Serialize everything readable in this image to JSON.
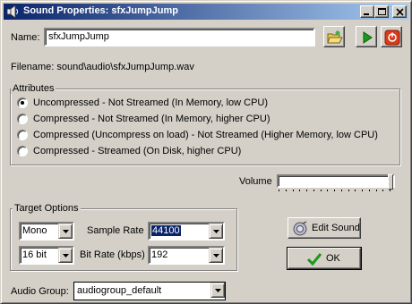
{
  "window": {
    "title": "Sound Properties: sfxJumpJump"
  },
  "name": {
    "label": "Name:",
    "value": "sfxJumpJump"
  },
  "filename": {
    "text": "Filename: sound\\audio\\sfxJumpJump.wav"
  },
  "toolbar": {
    "load_icon": "folder-open-icon",
    "play_icon": "play-icon",
    "stop_icon": "stop-icon"
  },
  "attributes": {
    "title": "Attributes",
    "options": [
      {
        "label": "Uncompressed - Not Streamed (In Memory, low CPU)",
        "selected": true
      },
      {
        "label": "Compressed - Not Streamed (In Memory, higher CPU)",
        "selected": false
      },
      {
        "label": "Compressed (Uncompress on load) - Not Streamed (Higher Memory, low CPU)",
        "selected": false
      },
      {
        "label": "Compressed - Streamed (On Disk, higher CPU)",
        "selected": false
      }
    ]
  },
  "volume": {
    "label": "Volume",
    "level": 1.0
  },
  "target_options": {
    "title": "Target Options",
    "channels": "Mono",
    "bit_depth": "16 bit",
    "sample_rate_label": "Sample Rate",
    "sample_rate": "44100",
    "bit_rate_label": "Bit Rate (kbps)",
    "bit_rate": "192"
  },
  "buttons": {
    "edit_sound": "Edit Sound",
    "ok": "OK"
  },
  "audio_group": {
    "label": "Audio Group:",
    "value": "audiogroup_default"
  },
  "colors": {
    "face": "#d4d0c8",
    "title_active": "#0a246a",
    "play_green": "#1a9a1a",
    "stop_red": "#d83a1a"
  }
}
